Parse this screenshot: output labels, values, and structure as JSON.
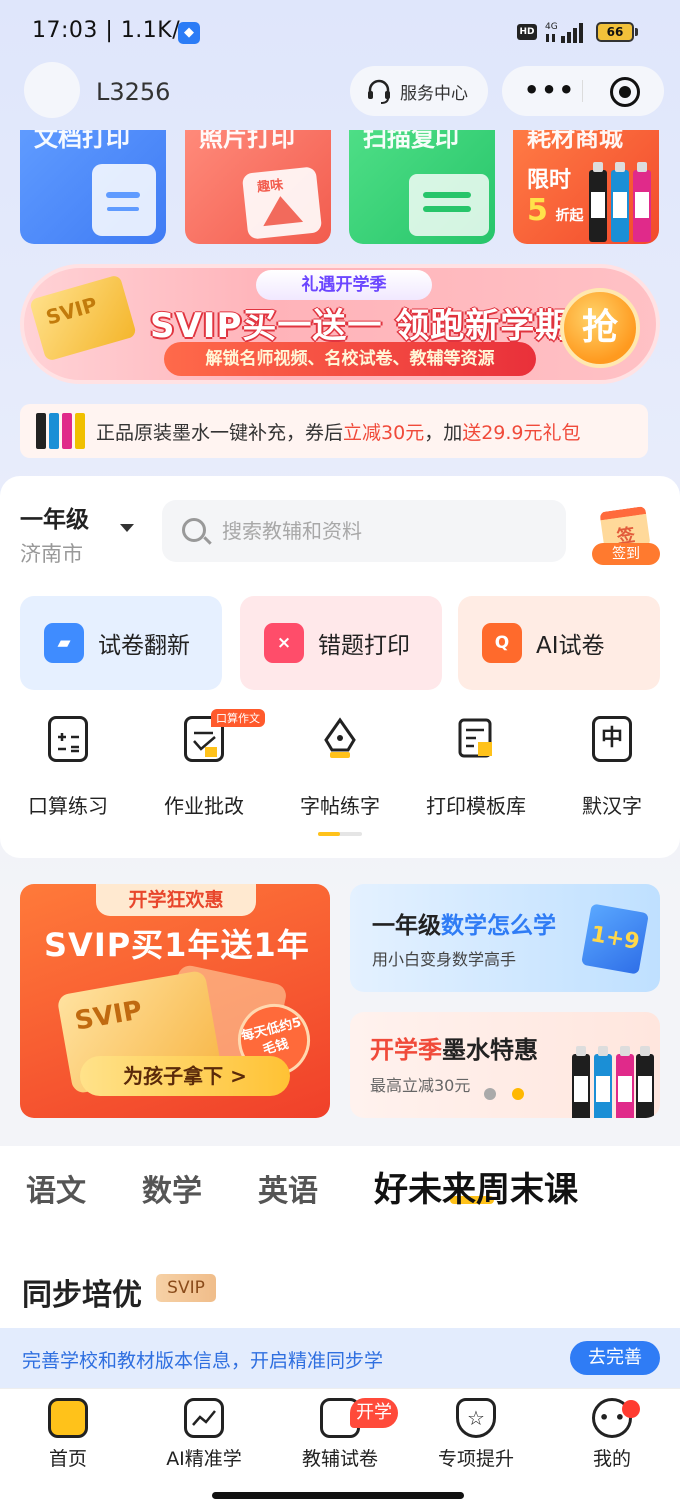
{
  "status_bar": {
    "time": "17:03",
    "speed": "1.1K/s",
    "hd": "HD",
    "network": "4G",
    "battery": "66"
  },
  "header": {
    "username": "L3256",
    "service_center": "服务中心",
    "capsule_more": "•••"
  },
  "services": [
    {
      "label": "文档打印"
    },
    {
      "label": "照片打印",
      "badge": "趣味"
    },
    {
      "label": "扫描复印"
    },
    {
      "label": "耗材商城",
      "promo_line1": "限时",
      "promo_num": "5",
      "promo_unit": "折起"
    }
  ],
  "svip_banner": {
    "tag": "礼遇开学季",
    "headline": "SVIP买一送一 领跑新学期",
    "subline": "解锁名师视频、名校试卷、教辅等资源",
    "grab": "抢",
    "card_text": "SVIP"
  },
  "ink_strip": {
    "text_a": "正品原装墨水一键补充，券后",
    "text_b": "立减30元",
    "text_c": "，加",
    "text_d": "送29.9元礼包"
  },
  "filter": {
    "grade": "一年级",
    "city": "济南市",
    "search_placeholder": "搜索教辅和资料",
    "signin_icon": "签",
    "signin_label": "签到"
  },
  "features": [
    {
      "label": "试卷翻新",
      "color": "#3f8cff"
    },
    {
      "label": "错题打印",
      "color": "#ff4d6a",
      "glyph": "×"
    },
    {
      "label": "AI试卷",
      "color": "#ff6a2c",
      "glyph": "Q"
    }
  ],
  "tools": [
    {
      "label": "口算练习",
      "icon": "calculator-icon"
    },
    {
      "label": "作业批改",
      "icon": "homework-check-icon",
      "hot": "口算作文"
    },
    {
      "label": "字帖练字",
      "icon": "pen-nib-icon"
    },
    {
      "label": "打印模板库",
      "icon": "template-icon"
    },
    {
      "label": "默汉字",
      "icon": "hanzi-icon",
      "glyph": "中"
    }
  ],
  "promo_big": {
    "tag": "开学狂欢惠",
    "headline": "SVIP买1年送1年",
    "card": "SVIP",
    "stamp": "每天低约5毛钱",
    "button": "为孩子拿下 >"
  },
  "promo_math": {
    "headline_a": "一年级",
    "headline_b": "数学怎么学",
    "sub": "用小白变身数学高手",
    "book": "1+9"
  },
  "promo_ink": {
    "headline_a": "开学季",
    "headline_b": "墨水特惠",
    "sub": "最高立减30元"
  },
  "subject_tabs": [
    {
      "label": "语文"
    },
    {
      "label": "数学"
    },
    {
      "label": "英语"
    },
    {
      "label": "好未来周末课",
      "active": true
    }
  ],
  "section": {
    "title": "同步培优",
    "badge": "SVIP"
  },
  "notice": {
    "text": "完善学校和教材版本信息，开启精准同步学",
    "button": "去完善"
  },
  "bottom_nav": [
    {
      "label": "首页",
      "active": true
    },
    {
      "label": "AI精准学"
    },
    {
      "label": "教辅试卷",
      "badge": "开学"
    },
    {
      "label": "专项提升"
    },
    {
      "label": "我的"
    }
  ],
  "colors": {
    "accent_yellow": "#ffc21a",
    "accent_red": "#f04a3a",
    "accent_blue": "#2f7cf5"
  }
}
